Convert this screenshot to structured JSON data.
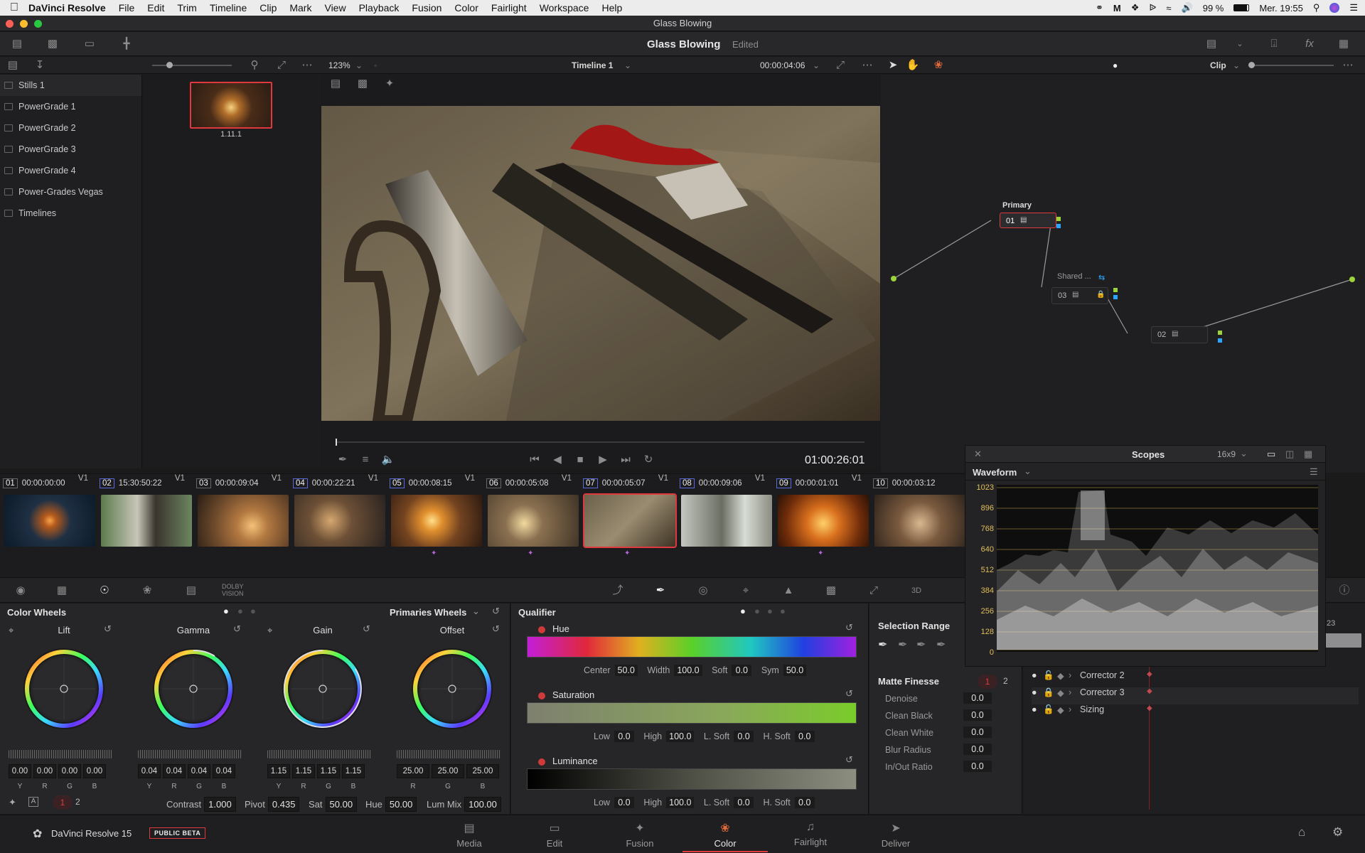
{
  "menubar": {
    "app": "DaVinci Resolve",
    "items": [
      "File",
      "Edit",
      "Trim",
      "Timeline",
      "Clip",
      "Mark",
      "View",
      "Playback",
      "Fusion",
      "Color",
      "Fairlight",
      "Workspace",
      "Help"
    ],
    "battery": "99 %",
    "clock": "Mer. 19:55"
  },
  "window": {
    "title": "Glass Blowing"
  },
  "toolbar": {
    "project_title": "Glass Blowing",
    "status": "Edited"
  },
  "viewer": {
    "zoom": "123%",
    "timeline_name": "Timeline 1",
    "timecode": "00:00:04:06",
    "playhead_timecode": "01:00:26:01"
  },
  "nodes": {
    "mode": "Clip",
    "primary_title": "Primary",
    "shared_title": "Shared ...",
    "node1": "01",
    "node2": "02",
    "node3": "03"
  },
  "gallery": {
    "albums": [
      "Stills 1",
      "PowerGrade 1",
      "PowerGrade 2",
      "PowerGrade 3",
      "PowerGrade 4",
      "Power-Grades Vegas",
      "Timelines"
    ],
    "still_label": "1.11.1"
  },
  "clips": [
    {
      "num": "01",
      "tc": "00:00:00:00",
      "track": "V1"
    },
    {
      "num": "02",
      "tc": "15:30:50:22",
      "track": "V1"
    },
    {
      "num": "03",
      "tc": "00:00:09:04",
      "track": "V1"
    },
    {
      "num": "04",
      "tc": "00:00:22:21",
      "track": "V1"
    },
    {
      "num": "05",
      "tc": "00:00:08:15",
      "track": "V1"
    },
    {
      "num": "06",
      "tc": "00:00:05:08",
      "track": "V1"
    },
    {
      "num": "07",
      "tc": "00:00:05:07",
      "track": "V1"
    },
    {
      "num": "08",
      "tc": "00:00:09:06",
      "track": "V1"
    },
    {
      "num": "09",
      "tc": "00:00:01:01",
      "track": "V1"
    },
    {
      "num": "10",
      "tc": "00:00:03:12",
      "track": ""
    }
  ],
  "palette": {
    "dolby": "DOLBY",
    "vision": "VISION"
  },
  "color_wheels": {
    "title": "Color Wheels",
    "mode": "Primaries Wheels",
    "wheels": [
      {
        "name": "Lift",
        "values": [
          "0.00",
          "0.00",
          "0.00",
          "0.00"
        ],
        "labels": [
          "Y",
          "R",
          "G",
          "B"
        ]
      },
      {
        "name": "Gamma",
        "values": [
          "0.04",
          "0.04",
          "0.04",
          "0.04"
        ],
        "labels": [
          "Y",
          "R",
          "G",
          "B"
        ]
      },
      {
        "name": "Gain",
        "values": [
          "1.15",
          "1.15",
          "1.15",
          "1.15"
        ],
        "labels": [
          "Y",
          "R",
          "G",
          "B"
        ]
      },
      {
        "name": "Offset",
        "values": [
          "25.00",
          "25.00",
          "25.00"
        ],
        "labels": [
          "R",
          "G",
          "B"
        ]
      }
    ],
    "footer": {
      "page1": "1",
      "page2": "2",
      "contrast_label": "Contrast",
      "contrast": "1.000",
      "pivot_label": "Pivot",
      "pivot": "0.435",
      "sat_label": "Sat",
      "sat": "50.00",
      "hue_label": "Hue",
      "hue": "50.00",
      "lummix_label": "Lum Mix",
      "lummix": "100.00"
    }
  },
  "qualifier": {
    "title": "Qualifier",
    "hue": {
      "label": "Hue",
      "center_label": "Center",
      "center": "50.0",
      "width_label": "Width",
      "width": "100.0",
      "soft_label": "Soft",
      "soft": "0.0",
      "sym_label": "Sym",
      "sym": "50.0"
    },
    "saturation": {
      "label": "Saturation",
      "low_label": "Low",
      "low": "0.0",
      "high_label": "High",
      "high": "100.0",
      "lsoft_label": "L. Soft",
      "lsoft": "0.0",
      "hsoft_label": "H. Soft",
      "hsoft": "0.0"
    },
    "luminance": {
      "label": "Luminance",
      "low_label": "Low",
      "low": "0.0",
      "high_label": "High",
      "high": "100.0",
      "lsoft_label": "L. Soft",
      "lsoft": "0.0",
      "hsoft_label": "H. Soft",
      "hsoft": "0.0"
    }
  },
  "selection_range": {
    "title": "Selection Range",
    "matte_title": "Matte Finesse",
    "page1": "1",
    "page2": "2",
    "rows": [
      {
        "label": "Denoise",
        "value": "0.0"
      },
      {
        "label": "Clean Black",
        "value": "0.0"
      },
      {
        "label": "Clean White",
        "value": "0.0"
      },
      {
        "label": "Blur Radius",
        "value": "0.0"
      },
      {
        "label": "In/Out Ratio",
        "value": "0.0"
      }
    ]
  },
  "keyframes": {
    "tc_suffix": ":23",
    "rows": [
      "Corrector 2",
      "Corrector 3",
      "Sizing"
    ]
  },
  "scopes": {
    "title": "Scopes",
    "format": "16x9",
    "type": "Waveform",
    "ticks": [
      "1023",
      "896",
      "768",
      "640",
      "512",
      "384",
      "256",
      "128",
      "0"
    ]
  },
  "pagebar": {
    "brand": "DaVinci Resolve 15",
    "badge": "PUBLIC BETA",
    "pages": [
      "Media",
      "Edit",
      "Fusion",
      "Color",
      "Fairlight",
      "Deliver"
    ],
    "active": "Color"
  },
  "colors": {
    "accent_red": "#e0393d",
    "scope_ticks": "#e3bf5a",
    "node_link": "#9cd23a",
    "node_port": "#2aa6ff"
  }
}
